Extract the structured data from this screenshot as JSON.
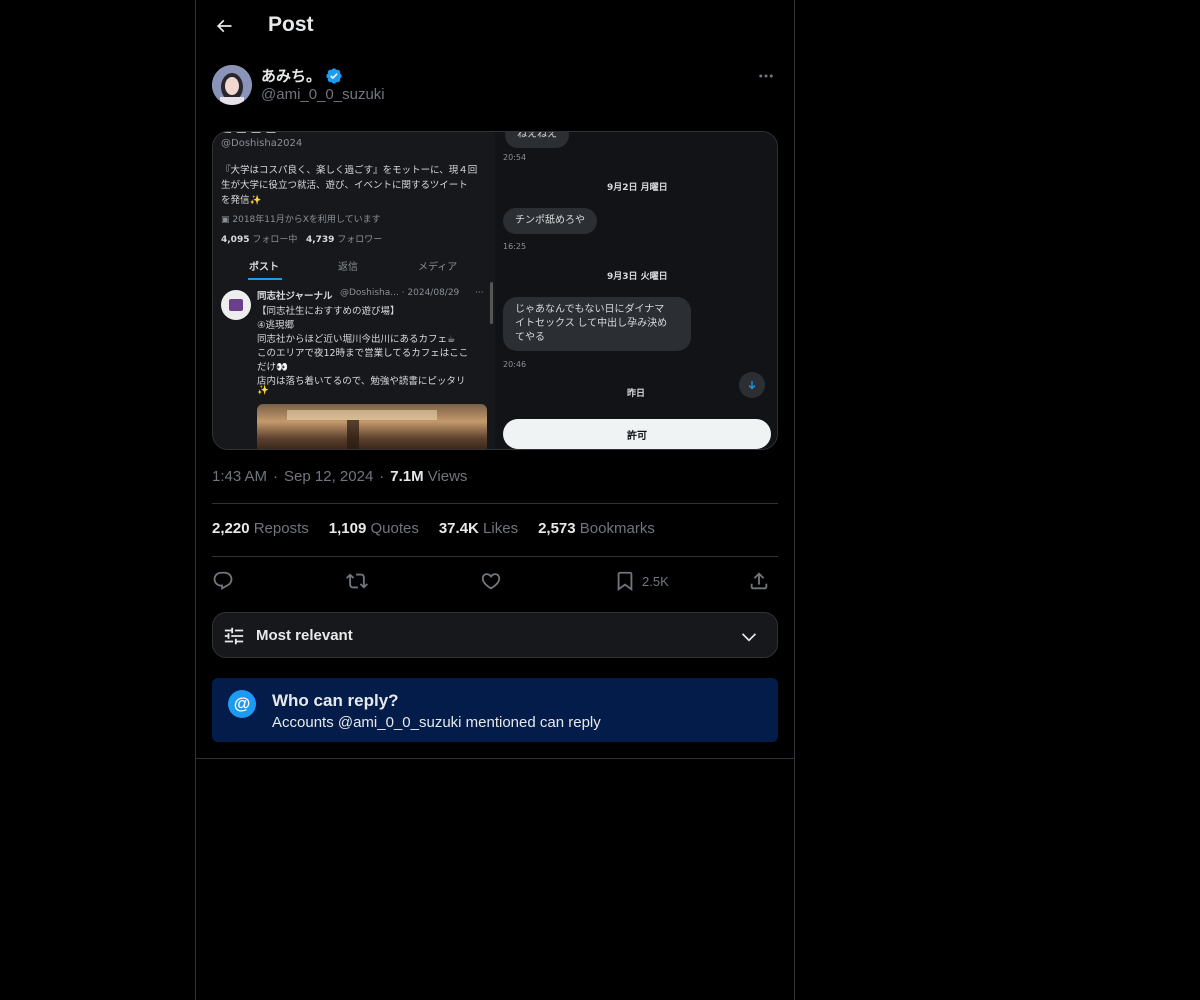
{
  "header": {
    "title": "Post",
    "back_icon": "arrow-left-icon"
  },
  "author": {
    "display_name": "あみち。",
    "handle": "@ami_0_0_suzuki",
    "verified_color": "#1d9bf0",
    "more_icon": "ellipsis-icon"
  },
  "media": {
    "left": {
      "top_fragment": "ー ー ー ー",
      "handle": "@Doshisha2024",
      "bio_line1": "『大学はコスパ良く、楽しく過ごす』をモットーに、現４回",
      "bio_line2": "生が大学に役立つ就活、遊び、イベントに関するツイート",
      "bio_line3": "を発信✨",
      "joined": "2018年11月からXを利用しています",
      "following_num": "4,095",
      "following_lbl": "フォロー中",
      "followers_num": "4,739",
      "followers_lbl": "フォロワー",
      "tabs": [
        "ポスト",
        "返信",
        "メディア"
      ],
      "post_name": "同志社ジャーナル",
      "post_meta": "@Doshisha... · 2024/08/29",
      "post_more": "···",
      "post_line1": "【同志社生におすすめの遊び場】",
      "post_line2": "④逃現郷",
      "post_line3": "同志社からほど近い堀川今出川にあるカフェ☕",
      "post_line4": "このエリアで夜12時まで営業してるカフェはここ",
      "post_line5": "だけ👀",
      "post_line6": "店内は落ち着いてるので、勉強や読書にピッタリ",
      "post_line7": "✨"
    },
    "right": {
      "bubble1": "ねえねえ",
      "time1": "20:54",
      "date1": "9月2日 月曜日",
      "bubble2": "チンポ舐めろや",
      "time2": "16:25",
      "date2": "9月3日 火曜日",
      "bubble3_line1": "じゃあなんでもない日にダイナマ",
      "bubble3_line2": "イトセックス して中出し孕み決め",
      "bubble3_line3": "てやる",
      "time3": "20:46",
      "date3": "昨日",
      "allow_button": "許可"
    }
  },
  "meta": {
    "time": "1:43 AM",
    "date": "Sep 12, 2024",
    "views_num": "7.1M",
    "views_lbl": "Views"
  },
  "stats": {
    "reposts_num": "2,220",
    "reposts_lbl": "Reposts",
    "quotes_num": "1,109",
    "quotes_lbl": "Quotes",
    "likes_num": "37.4K",
    "likes_lbl": "Likes",
    "bookmarks_num": "2,573",
    "bookmarks_lbl": "Bookmarks"
  },
  "actions": {
    "reply_icon": "reply-icon",
    "repost_icon": "repost-icon",
    "like_icon": "heart-icon",
    "bookmark_icon": "bookmark-icon",
    "bookmark_count": "2.5K",
    "share_icon": "share-icon"
  },
  "sort": {
    "label": "Most relevant",
    "icon": "sliders-icon",
    "chevron": "chevron-down-icon"
  },
  "reply_restriction": {
    "icon_glyph": "@",
    "title": "Who can reply?",
    "subtitle": "Accounts @ami_0_0_suzuki mentioned can reply"
  }
}
